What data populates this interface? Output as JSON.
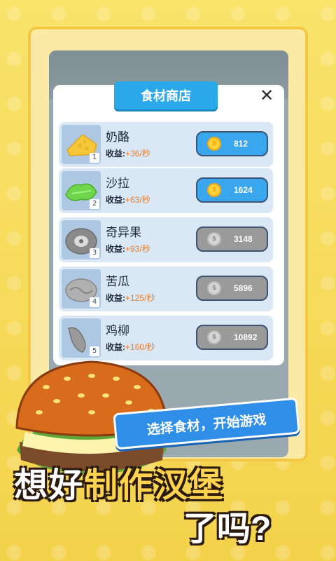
{
  "shop": {
    "title": "食材商店",
    "close_symbol": "✕",
    "income_label": "收益:",
    "items": [
      {
        "index": "1",
        "name": "奶酪",
        "income": "+36/秒",
        "price": "812",
        "state": "active",
        "icon": "cheese-icon"
      },
      {
        "index": "2",
        "name": "沙拉",
        "income": "+63/秒",
        "price": "1624",
        "state": "active",
        "icon": "lettuce-icon"
      },
      {
        "index": "3",
        "name": "奇异果",
        "income": "+93/秒",
        "price": "3148",
        "state": "locked",
        "icon": "kiwi-icon"
      },
      {
        "index": "4",
        "name": "苦瓜",
        "income": "+125/秒",
        "price": "5896",
        "state": "locked",
        "icon": "bitter-melon-icon"
      },
      {
        "index": "5",
        "name": "鸡柳",
        "income": "+160/秒",
        "price": "10892",
        "state": "locked",
        "icon": "chicken-strip-icon"
      }
    ]
  },
  "promo": {
    "subtitle": "选择食材，开始游戏",
    "headline_a": "想好",
    "headline_b": "制作汉堡",
    "headline_c": "了吗?"
  },
  "colors": {
    "accent": "#2aa8ea",
    "income": "#f27d2a",
    "background": "#f7dc5a"
  }
}
